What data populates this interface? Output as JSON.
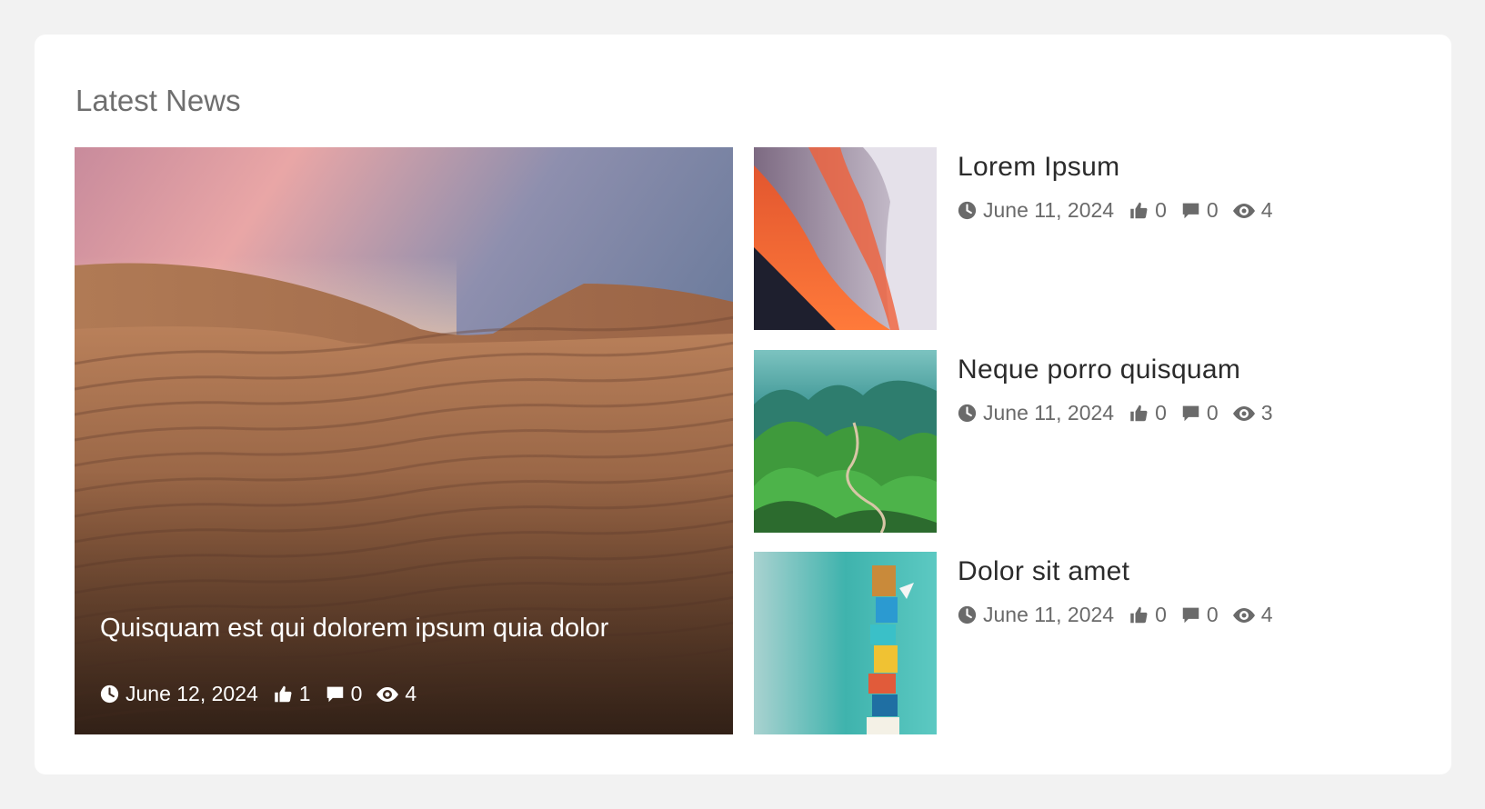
{
  "section": {
    "title": "Latest News"
  },
  "featured": {
    "title": "Quisquam est qui dolorem ipsum quia dolor",
    "date": "June 12, 2024",
    "likes": "1",
    "comments": "0",
    "views": "4",
    "image": "desert-dunes-image"
  },
  "articles": [
    {
      "title": "Lorem Ipsum",
      "date": "June 11, 2024",
      "likes": "0",
      "comments": "0",
      "views": "4",
      "image": "red-canyon-image"
    },
    {
      "title": "Neque porro quisquam",
      "date": "June 11, 2024",
      "likes": "0",
      "comments": "0",
      "views": "3",
      "image": "green-mountains-image"
    },
    {
      "title": "Dolor sit amet",
      "date": "June 11, 2024",
      "likes": "0",
      "comments": "0",
      "views": "4",
      "image": "book-tower-image"
    }
  ],
  "icons": [
    "clock-icon",
    "thumbs-up-icon",
    "comment-icon",
    "eye-icon"
  ],
  "colors": {
    "background": "#f2f2f2",
    "card": "#ffffff",
    "heading": "#6f6f6f",
    "title": "#2b2b2b",
    "meta": "#6a6a6a"
  }
}
